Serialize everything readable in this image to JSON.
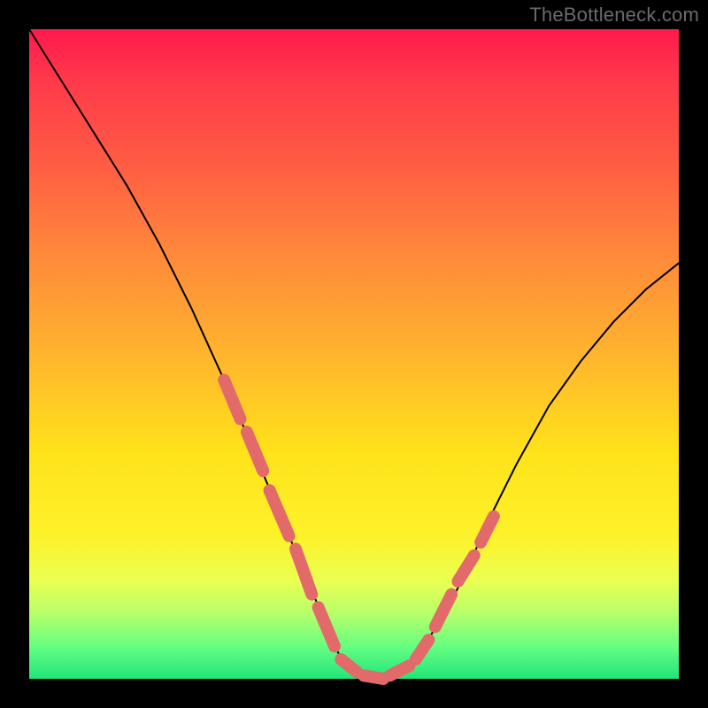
{
  "watermark": "TheBottleneck.com",
  "chart_data": {
    "type": "line",
    "title": "",
    "xlabel": "",
    "ylabel": "",
    "xlim": [
      0,
      100
    ],
    "ylim": [
      0,
      100
    ],
    "grid": false,
    "series": [
      {
        "name": "black-curve",
        "stroke": "#000000",
        "x": [
          0,
          5,
          10,
          15,
          20,
          25,
          30,
          35,
          40,
          45,
          48,
          50,
          52,
          55,
          58,
          60,
          62,
          65,
          68,
          70,
          75,
          80,
          85,
          90,
          95,
          100
        ],
        "y": [
          100,
          92,
          84,
          76,
          67,
          57,
          46,
          34,
          22,
          10,
          3,
          1,
          0,
          0,
          1,
          3,
          7,
          12,
          18,
          23,
          33,
          42,
          49,
          55,
          60,
          64
        ]
      },
      {
        "name": "salmon-dashes",
        "stroke": "#e36a6a",
        "segments": [
          {
            "x": [
              30,
              32.5
            ],
            "y": [
              46,
              40
            ]
          },
          {
            "x": [
              33.5,
              36
            ],
            "y": [
              38,
              32
            ]
          },
          {
            "x": [
              37,
              40
            ],
            "y": [
              29,
              22
            ]
          },
          {
            "x": [
              41,
              43.5
            ],
            "y": [
              20,
              13
            ]
          },
          {
            "x": [
              44.5,
              47
            ],
            "y": [
              11,
              5
            ]
          },
          {
            "x": [
              48,
              50.5
            ],
            "y": [
              3,
              1
            ]
          },
          {
            "x": [
              51.5,
              54.5
            ],
            "y": [
              0.5,
              0
            ]
          },
          {
            "x": [
              55.5,
              58.5
            ],
            "y": [
              0.5,
              2
            ]
          },
          {
            "x": [
              59.5,
              61.5
            ],
            "y": [
              3,
              6
            ]
          },
          {
            "x": [
              62.5,
              65
            ],
            "y": [
              8,
              13
            ]
          },
          {
            "x": [
              66,
              68.5
            ],
            "y": [
              15,
              19
            ]
          },
          {
            "x": [
              69.5,
              71.5
            ],
            "y": [
              21,
              25
            ]
          }
        ]
      }
    ]
  }
}
